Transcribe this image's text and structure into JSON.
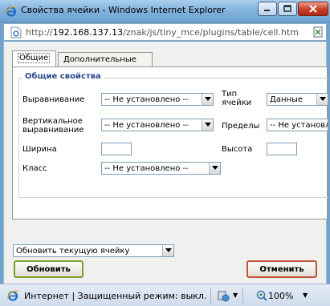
{
  "window": {
    "title": "Свойства ячейки - Windows Internet Explorer",
    "minimize_icon": "minimize-icon",
    "maximize_icon": "maximize-icon",
    "close_icon": "close-icon"
  },
  "address": {
    "scheme": "http://",
    "host": "192.168.137.13",
    "path": "/znak/js/tiny_mce/plugins/table/cell.htm"
  },
  "tabs": [
    {
      "label": "Общие",
      "active": true
    },
    {
      "label": "Дополнительные",
      "active": false
    }
  ],
  "general": {
    "legend": "Общие свойства",
    "align_label": "Выравнивание",
    "align_value": "-- Не установлено --",
    "celltype_label_line1": "Тип",
    "celltype_label_line2": "ячейки",
    "celltype_value": "Данные",
    "valign_label_line1": "Вертикальное",
    "valign_label_line2": "выравнивание",
    "valign_value": "-- Не установлено --",
    "scope_label": "Пределы",
    "scope_value": "-- Не установлено --",
    "width_label": "Ширина",
    "width_value": "",
    "height_label": "Высота",
    "height_value": "",
    "class_label": "Класс",
    "class_value": "-- Не установлено --"
  },
  "footer": {
    "action_value": "Обновить текущую ячейку",
    "update_label": "Обновить",
    "cancel_label": "Отменить"
  },
  "status": {
    "text": "Интернет | Защищенный режим: выкл.",
    "zoom": "100%"
  },
  "colors": {
    "titlebar": "#7fb0db",
    "legend": "#2b4a8a",
    "update_border": "#7da028",
    "cancel_border": "#c2533b",
    "close_button": "#c9412a"
  }
}
